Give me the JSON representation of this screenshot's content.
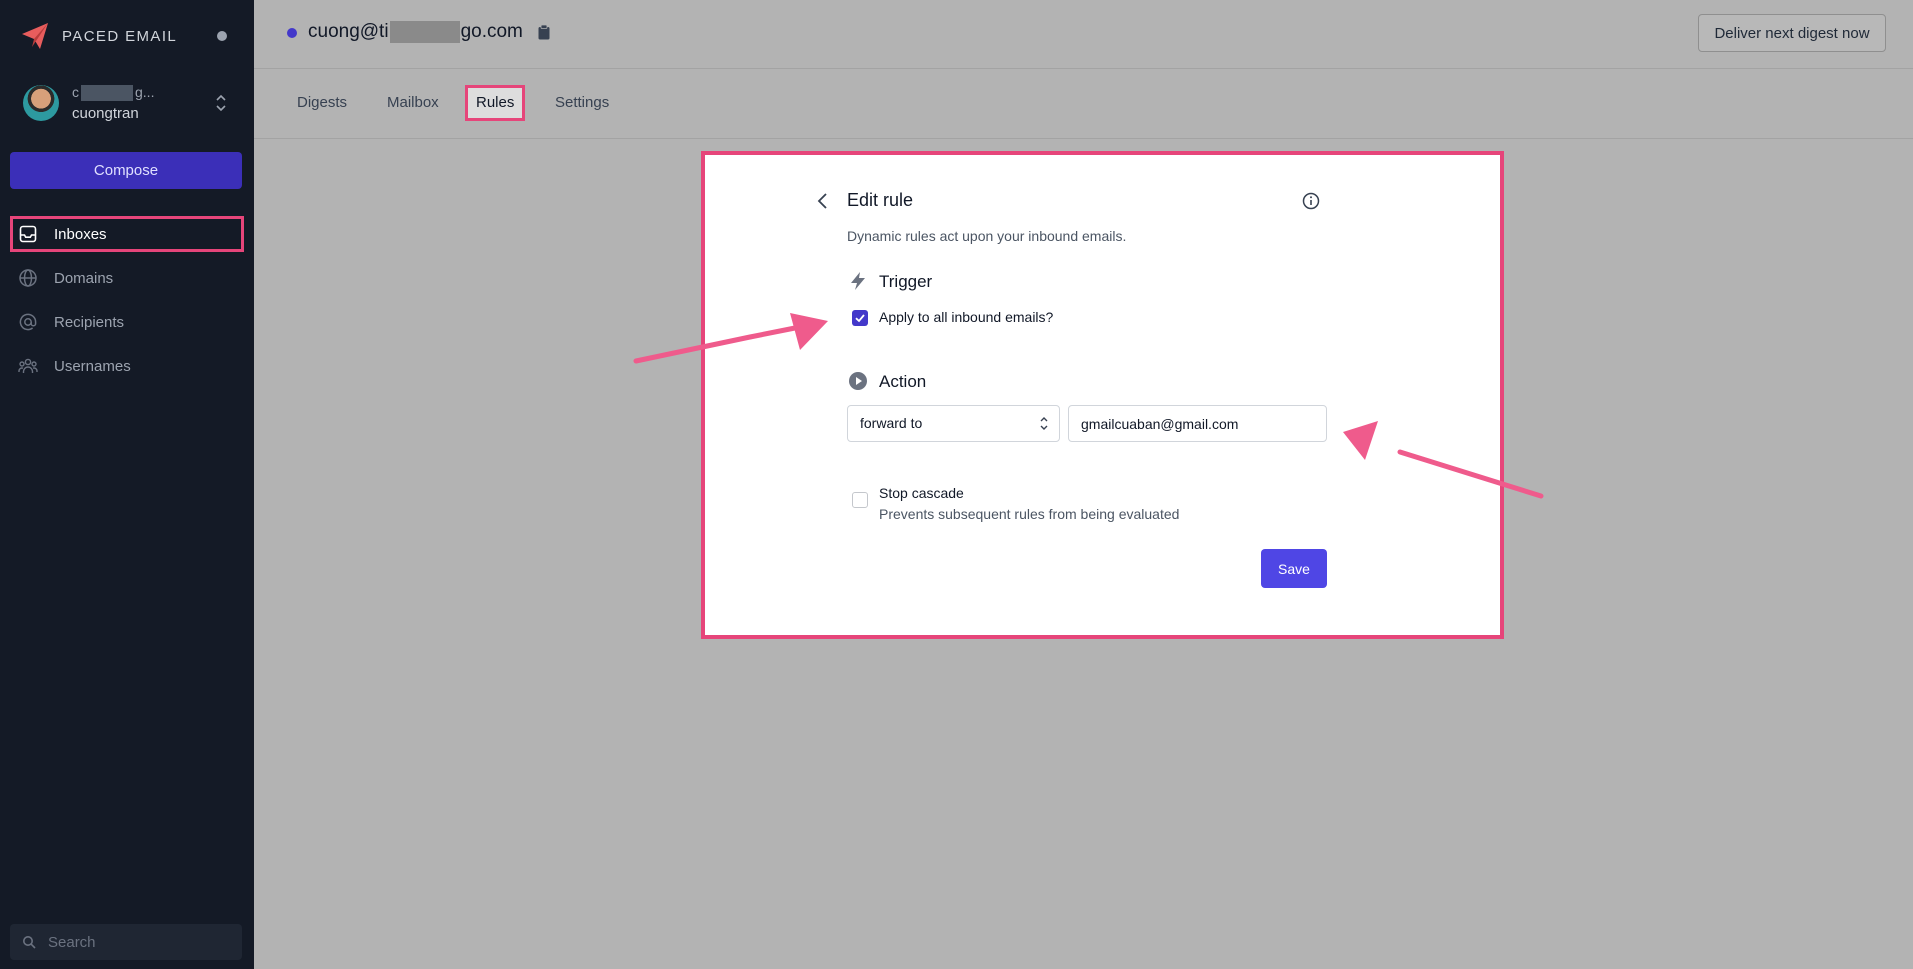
{
  "brand": {
    "name": "PACED EMAIL"
  },
  "account": {
    "email_start": "c",
    "email_end": "g...",
    "username": "cuongtran"
  },
  "sidebar": {
    "compose_label": "Compose",
    "items": [
      {
        "label": "Inboxes",
        "icon": "inbox-icon"
      },
      {
        "label": "Domains",
        "icon": "globe-icon"
      },
      {
        "label": "Recipients",
        "icon": "at-icon"
      },
      {
        "label": "Usernames",
        "icon": "users-icon"
      }
    ],
    "search_placeholder": "Search"
  },
  "header": {
    "inbox_prefix": "cuong@ti",
    "inbox_suffix": "go.com",
    "deliver_label": "Deliver next digest now"
  },
  "tabs": [
    {
      "label": "Digests"
    },
    {
      "label": "Mailbox"
    },
    {
      "label": "Rules"
    },
    {
      "label": "Settings"
    }
  ],
  "rule": {
    "title": "Edit rule",
    "subtitle": "Dynamic rules act upon your inbound emails.",
    "trigger_title": "Trigger",
    "apply_all_label": "Apply to all inbound emails?",
    "apply_all_checked": true,
    "action_title": "Action",
    "action_selected": "forward to",
    "action_value": "gmailcuaban@gmail.com",
    "stop_cascade_label": "Stop cascade",
    "stop_cascade_hint": "Prevents subsequent rules from being evaluated",
    "stop_cascade_checked": false,
    "save_label": "Save"
  },
  "colors": {
    "accent": "#4f46e5",
    "highlight": "#e6457a",
    "sidebar": "#141a26"
  }
}
